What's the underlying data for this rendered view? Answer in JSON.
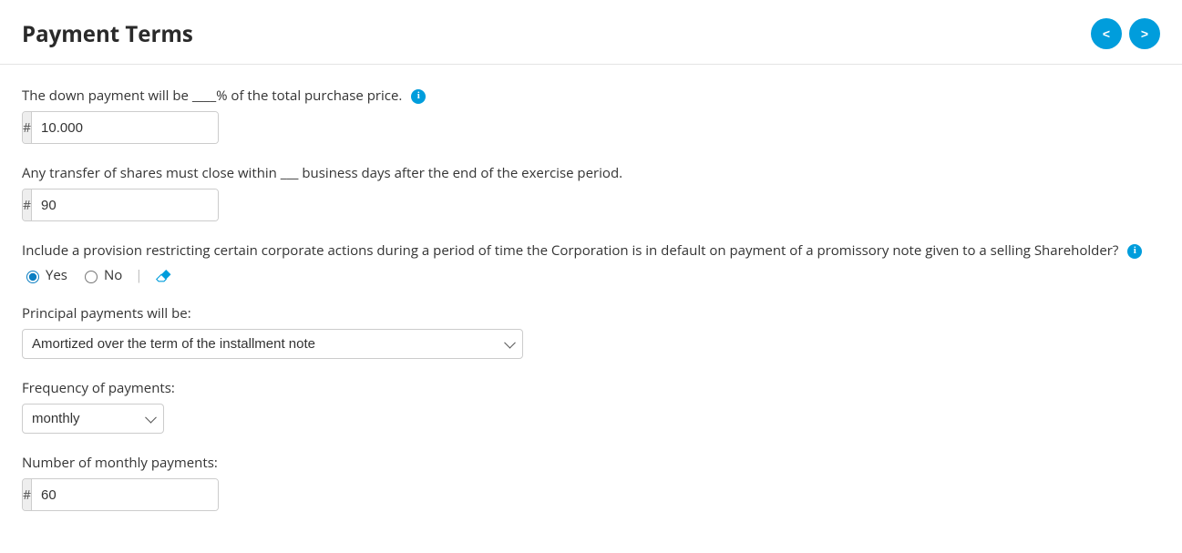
{
  "header": {
    "title": "Payment Terms"
  },
  "nav": {
    "prev": "<",
    "next": ">"
  },
  "hash": "#",
  "info_glyph": "i",
  "fields": {
    "down_payment": {
      "label": "The down payment will be ____% of the total purchase price.",
      "value": "10.000"
    },
    "close_days": {
      "label": "Any transfer of shares must close within ___ business days after the end of the exercise period.",
      "value": "90"
    },
    "provision": {
      "label": "Include a provision restricting certain corporate actions during a period of time the Corporation is in default on payment of a promissory note given to a selling Shareholder?",
      "yes": "Yes",
      "no": "No",
      "selected": "yes"
    },
    "principal": {
      "label": "Principal payments will be:",
      "value": "Amortized over the term of the installment note"
    },
    "frequency": {
      "label": "Frequency of payments:",
      "value": "monthly"
    },
    "num_payments": {
      "label": "Number of monthly payments:",
      "value": "60"
    }
  }
}
